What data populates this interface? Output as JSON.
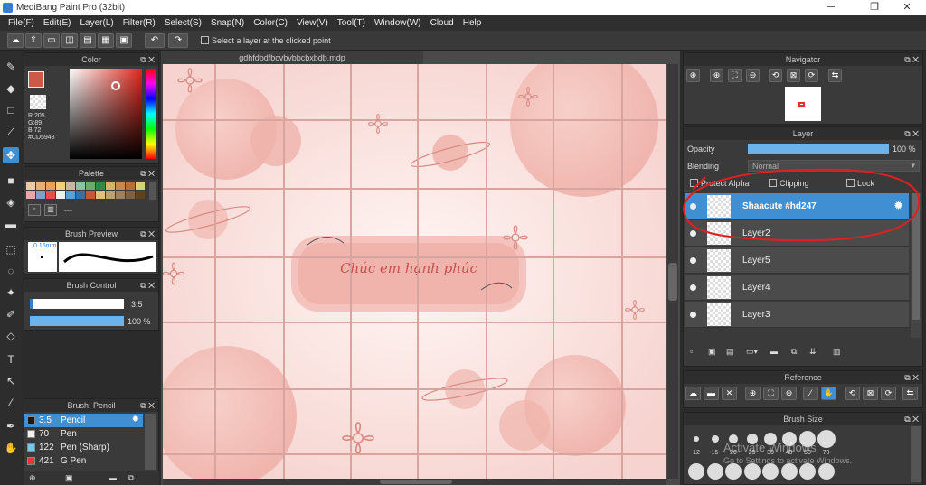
{
  "window": {
    "title": "MediBang Paint Pro (32bit)",
    "minimize": "─",
    "maximize": "❐",
    "close": "✕"
  },
  "menu": [
    "File(F)",
    "Edit(E)",
    "Layer(L)",
    "Filter(R)",
    "Select(S)",
    "Snap(N)",
    "Color(C)",
    "View(V)",
    "Tool(T)",
    "Window(W)",
    "Cloud",
    "Help"
  ],
  "toolbar": {
    "select_layer_label": "Select a layer at the clicked point"
  },
  "document": {
    "tab": "gdhfdbdfbcvbvbbcbxbdb.mdp"
  },
  "color_panel": {
    "title": "Color",
    "r": "R:205",
    "g": "G:89",
    "b": "B:72",
    "hex": "#CD5948",
    "main_color": "#CD5948"
  },
  "palette_panel": {
    "title": "Palette",
    "colors": [
      "#e9c9a6",
      "#e6b07a",
      "#e8a45a",
      "#f0d07a",
      "#c7b9a0",
      "#8bc3a0",
      "#6da86d",
      "#2f8a48",
      "#d6b36a",
      "#c48a50",
      "#b46f3a",
      "#d7d07a",
      "#e9a6a6",
      "#7fa1c9",
      "#e45050",
      "#f0f0f0",
      "#5aa0d6",
      "#3a6fa0",
      "#c25a3a",
      "#e0c080",
      "#c0a070",
      "#a08060",
      "#806040",
      "#604020"
    ],
    "suffix": "---"
  },
  "brush_preview": {
    "title": "Brush Preview",
    "size": "0.15mm"
  },
  "brush_control": {
    "title": "Brush Control",
    "size_value": "3.5",
    "opacity_value": "100 %",
    "opacity_fraction": 1.0
  },
  "brush_list": {
    "title": "Brush: Pencil",
    "items": [
      {
        "size": "3.5",
        "name": "Pencil",
        "color": "#1a1a1a",
        "selected": true
      },
      {
        "size": "70",
        "name": "Pen",
        "color": "#f0f0f0",
        "selected": false
      },
      {
        "size": "122",
        "name": "Pen (Sharp)",
        "color": "#7ac5ee",
        "selected": false
      },
      {
        "size": "421",
        "name": "G Pen",
        "color": "#e53935",
        "selected": false
      }
    ]
  },
  "navigator": {
    "title": "Navigator"
  },
  "layer_panel": {
    "title": "Layer",
    "opacity_label": "Opacity",
    "opacity_value": "100 %",
    "opacity_fraction": 1.0,
    "blending_label": "Blending",
    "blending_value": "Normal",
    "protect_alpha": "Protect Alpha",
    "clipping": "Clipping",
    "lock": "Lock",
    "layers": [
      {
        "name": "Shaacute #hd247",
        "selected": true
      },
      {
        "name": "Layer2",
        "selected": false
      },
      {
        "name": "Layer5",
        "selected": false
      },
      {
        "name": "Layer4",
        "selected": false
      },
      {
        "name": "Layer3",
        "selected": false
      }
    ]
  },
  "reference": {
    "title": "Reference"
  },
  "brush_size": {
    "title": "Brush Size",
    "sizes": [
      "12",
      "15",
      "20",
      "25",
      "30",
      "40",
      "50",
      "70"
    ],
    "watermark_line1": "Activate Windows",
    "watermark_line2": "Go to Settings to activate Windows."
  },
  "artwork": {
    "text": "Chúc em hạnh phúc",
    "accent": "#f2b9b2",
    "grid_color": "#d9a9a5"
  }
}
